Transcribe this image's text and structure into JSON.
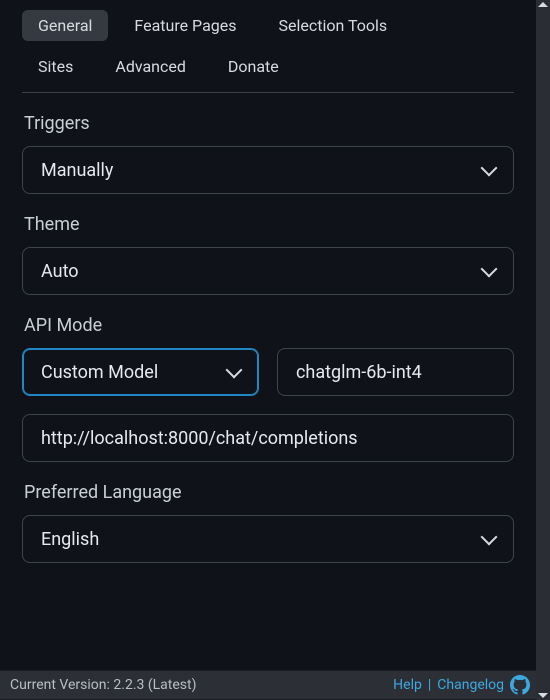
{
  "tabs": {
    "row1": [
      "General",
      "Feature Pages",
      "Selection Tools"
    ],
    "row2": [
      "Sites",
      "Advanced",
      "Donate"
    ],
    "active": "General"
  },
  "labels": {
    "triggers": "Triggers",
    "theme": "Theme",
    "api_mode": "API Mode",
    "preferred_language": "Preferred Language"
  },
  "values": {
    "triggers": "Manually",
    "theme": "Auto",
    "api_mode": "Custom Model",
    "model_name": "chatglm-6b-int4",
    "endpoint": "http://localhost:8000/chat/completions",
    "preferred_language": "English"
  },
  "status": {
    "version": "Current Version: 2.2.3 (Latest)",
    "help": "Help",
    "sep": "|",
    "changelog": "Changelog"
  }
}
